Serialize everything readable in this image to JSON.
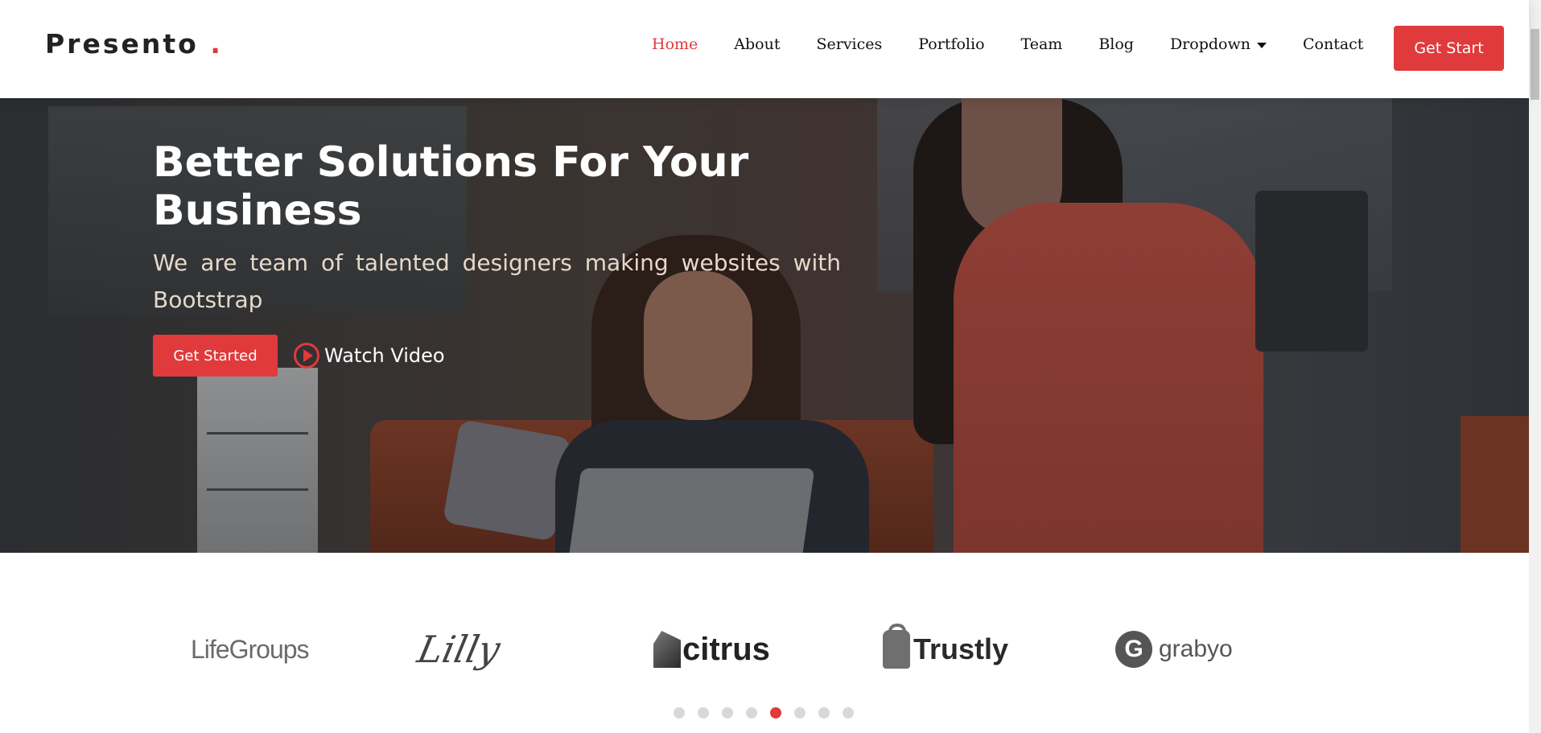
{
  "brand": {
    "name": "Presento",
    "dot": ".",
    "accent_color": "#e03a3c"
  },
  "nav": {
    "items": [
      {
        "label": "Home",
        "active": true
      },
      {
        "label": "About"
      },
      {
        "label": "Services"
      },
      {
        "label": "Portfolio"
      },
      {
        "label": "Team"
      },
      {
        "label": "Blog"
      },
      {
        "label": "Dropdown",
        "has_caret": true
      },
      {
        "label": "Contact"
      }
    ],
    "cta_label": "Get Start"
  },
  "hero": {
    "title": "Better Solutions For Your Business",
    "subtitle": "We are team of talented designers making websites with Bootstrap",
    "primary_button": "Get Started",
    "video_link": "Watch Video"
  },
  "clients": {
    "logos": [
      {
        "name": "LifeGroups"
      },
      {
        "name": "Lilly"
      },
      {
        "name": "citrus"
      },
      {
        "name": "Trustly"
      },
      {
        "name": "grabyo",
        "mark": "G"
      }
    ],
    "carousel": {
      "total": 8,
      "active_index": 4
    }
  }
}
